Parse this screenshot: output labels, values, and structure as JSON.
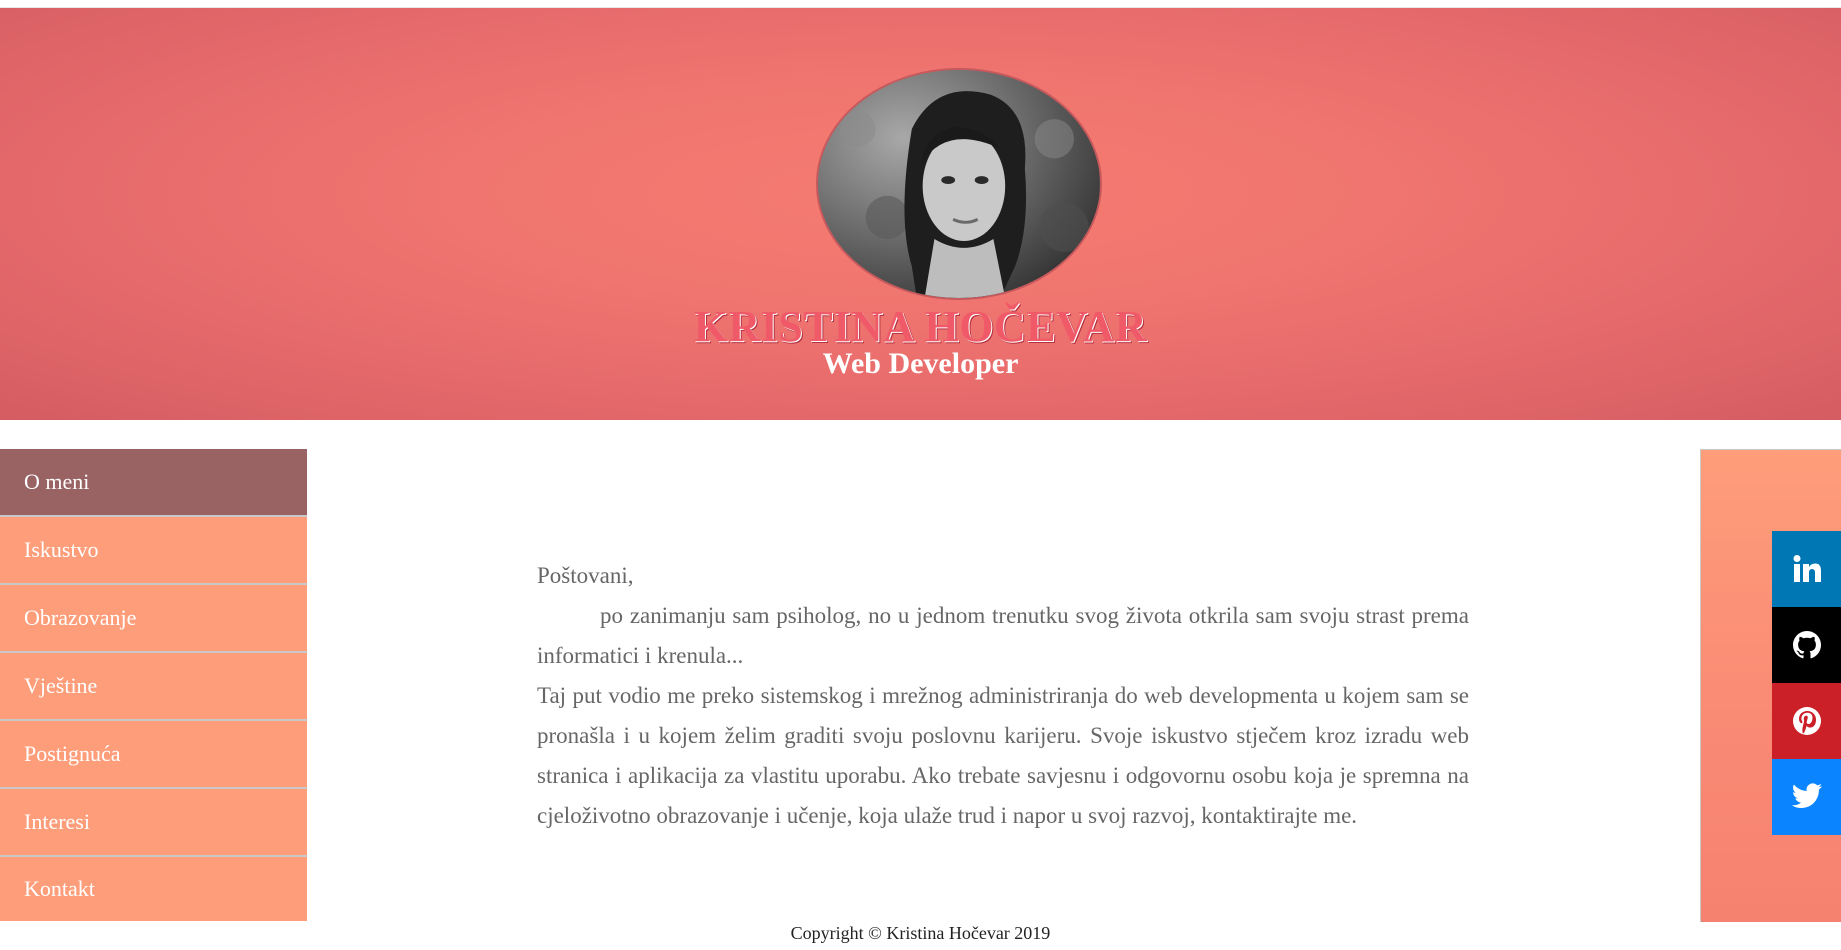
{
  "header": {
    "name": "KRISTINA HOČEVAR",
    "subtitle": "Web Developer",
    "avatar": "profile-photo"
  },
  "sidebar": {
    "items": [
      {
        "label": "O meni",
        "active": true
      },
      {
        "label": "Iskustvo"
      },
      {
        "label": "Obrazovanje"
      },
      {
        "label": "Vještine"
      },
      {
        "label": "Postignuća"
      },
      {
        "label": "Interesi"
      },
      {
        "label": "Kontakt"
      }
    ]
  },
  "content": {
    "greeting": "Poštovani,",
    "paragraph1": "po zanimanju sam psiholog, no u jednom trenutku svog života otkrila sam svoju strast prema informatici i krenula...",
    "paragraph2": "Taj put vodio me preko sistemskog i mrežnog administriranja do web developmenta u kojem sam se pronašla i u kojem želim graditi svoju poslovnu karijeru. Svoje iskustvo stječem kroz izradu web stranica i aplikacija za vlastitu uporabu. Ako trebate savjesnu i odgovornu osobu koja je spremna na cjeloživotno obrazovanje i učenje, koja ulaže trud i napor u svoj razvoj, kontaktirajte me."
  },
  "social": [
    {
      "icon": "linkedin-icon",
      "color": "#0077b5"
    },
    {
      "icon": "github-icon",
      "color": "#000000"
    },
    {
      "icon": "pinterest-icon",
      "color": "#cb2027"
    },
    {
      "icon": "twitter-icon",
      "color": "#0a84ff"
    }
  ],
  "footer": {
    "copyright": "Copyright © Kristina Hočevar 2019"
  },
  "colors": {
    "header_accent": "#f07570",
    "menu_item": "#fe9d7a",
    "menu_active": "#996364",
    "name_text": "#f05a68"
  }
}
